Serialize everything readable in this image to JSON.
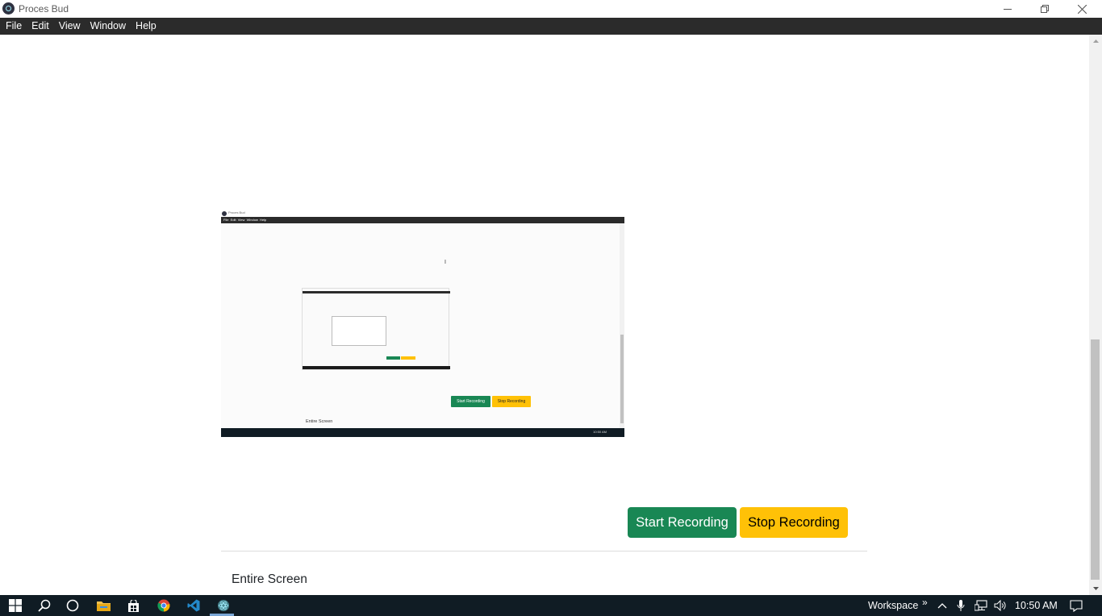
{
  "window": {
    "title": "Proces Bud",
    "controls": [
      "minimize-icon",
      "restore-icon",
      "close-icon"
    ]
  },
  "menu": {
    "items": [
      "File",
      "Edit",
      "View",
      "Window",
      "Help"
    ]
  },
  "preview": {
    "title": "Proces Bud",
    "menu_text": "File  Edit  View  Window  Help",
    "start_label": "Start Recording",
    "stop_label": "Stop Recording",
    "source_label": "Entire Screen",
    "clock": "10:50 AM"
  },
  "controls": {
    "start_label": "Start Recording",
    "stop_label": "Stop Recording",
    "start_color": "#198754",
    "stop_color": "#ffc107"
  },
  "source": {
    "label": "Entire Screen"
  },
  "taskbar": {
    "icons": [
      "windows-start-icon",
      "search-icon",
      "cortana-icon",
      "file-explorer-icon",
      "store-icon",
      "chrome-icon",
      "vscode-icon",
      "electron-app-icon"
    ],
    "workspace_label": "Workspace",
    "overflow_label": "»",
    "tray_icons": [
      "chevron-up-icon",
      "microphone-icon",
      "network-icon",
      "volume-icon"
    ],
    "clock": "10:50 AM",
    "notification_icon": "notification-icon"
  }
}
